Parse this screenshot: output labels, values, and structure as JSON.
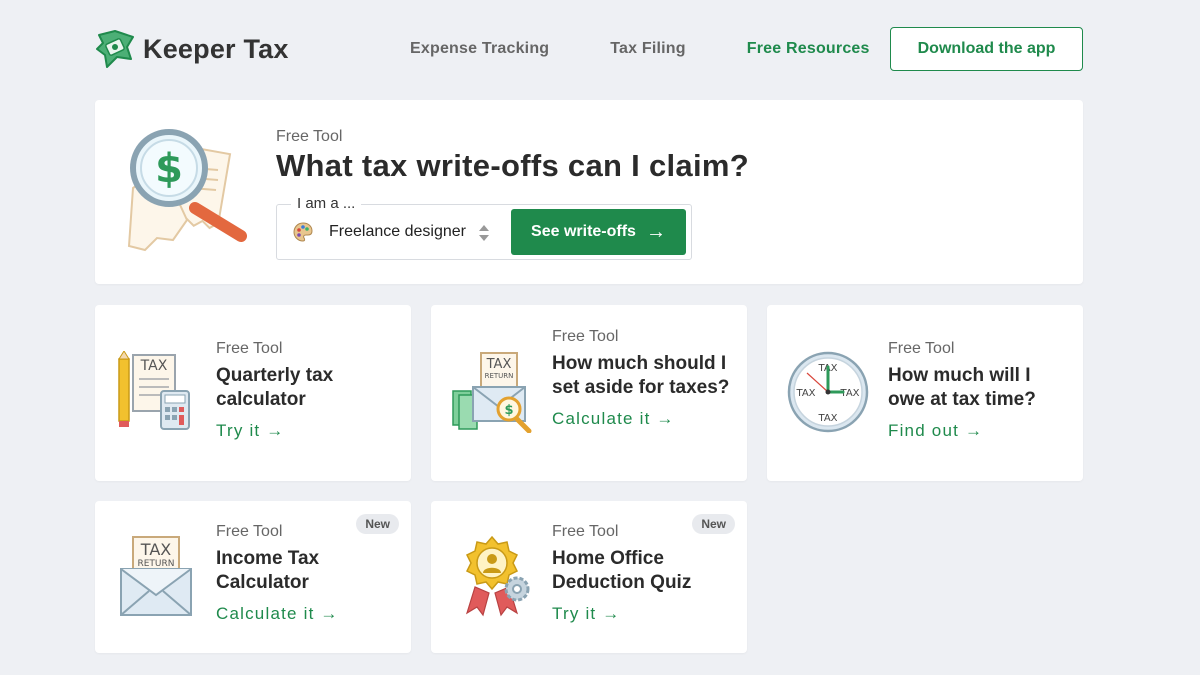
{
  "header": {
    "brand": "Keeper Tax",
    "nav": [
      {
        "label": "Expense Tracking"
      },
      {
        "label": "Tax Filing"
      },
      {
        "label": "Free Resources"
      }
    ],
    "cta_label": "Download the app"
  },
  "hero": {
    "eyebrow": "Free Tool",
    "title": "What tax write-offs can I claim?",
    "selector_legend": "I am a ...",
    "selector_value": "Freelance designer",
    "button_label": "See write-offs",
    "button_arrow": "→"
  },
  "tools": [
    {
      "eyebrow": "Free Tool",
      "title": "Quarterly tax calculator",
      "link": "Try it →"
    },
    {
      "eyebrow": "Free Tool",
      "title": "How much should I set aside for taxes?",
      "link": "Calculate it →"
    },
    {
      "eyebrow": "Free Tool",
      "title": "How much will I owe at tax time?",
      "link": "Find out →"
    },
    {
      "eyebrow": "Free Tool",
      "title": "Income Tax Calculator",
      "link": "Calculate it →",
      "badge": "New"
    },
    {
      "eyebrow": "Free Tool",
      "title": "Home Office Deduction Quiz",
      "link": "Try it →",
      "badge": "New"
    }
  ],
  "illustration_text": {
    "tax": "TAX",
    "return": "RETURN",
    "dollar": "$"
  },
  "colors": {
    "brand_green": "#1f8a4c",
    "background": "#eef0f4",
    "magnifier_handle": "#e3683f",
    "badge_gold": "#f2c12e"
  }
}
